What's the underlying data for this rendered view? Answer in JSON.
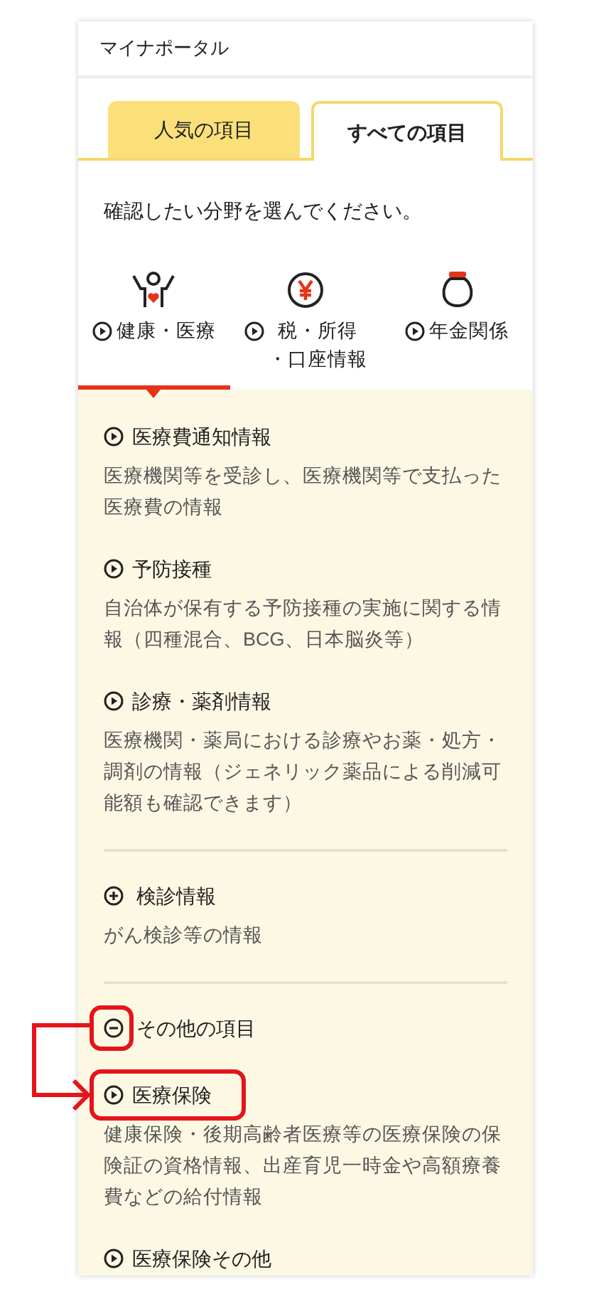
{
  "header": {
    "title": "マイナポータル"
  },
  "tabs": [
    {
      "label": "人気の項目",
      "selected": false
    },
    {
      "label": "すべての項目",
      "selected": true
    }
  ],
  "prompt": "確認したい分野を選んでください。",
  "categories": [
    {
      "lines": [
        "健康・医療"
      ],
      "selected": true
    },
    {
      "lines": [
        "税・所得",
        "・口座情報"
      ],
      "selected": false
    },
    {
      "lines": [
        "年金関係"
      ],
      "selected": false
    }
  ],
  "groups": [
    {
      "items": [
        {
          "kind": "link",
          "title": "医療費通知情報",
          "description": "医療機関等を受診し、医療機関等で支払った医療費の情報",
          "highlighted": false
        },
        {
          "kind": "link",
          "title": "予防接種",
          "description": "自治体が保有する予防接種の実施に関する情報（四種混合、BCG、日本脳炎等）",
          "highlighted": false
        },
        {
          "kind": "link",
          "title": "診療・薬剤情報",
          "description": "医療機関・薬局における診療やお薬・処方・調剤の情報（ジェネリック薬品による削減可能額も確認できます）",
          "highlighted": false
        }
      ]
    },
    {
      "items": [
        {
          "kind": "toggle",
          "expanded": false,
          "title": "検診情報",
          "description": "がん検診等の情報",
          "highlighted": false
        }
      ]
    },
    {
      "items": [
        {
          "kind": "toggle",
          "expanded": true,
          "title": "その他の項目",
          "highlighted": true
        },
        {
          "kind": "link",
          "title": "医療保険",
          "description": "健康保険・後期高齢者医療等の医療保険の保険証の資格情報、出産育児一時金や高額療養費などの給付情報",
          "highlighted": true
        },
        {
          "kind": "link",
          "title": "医療保険その他",
          "highlighted": false
        }
      ]
    }
  ]
}
